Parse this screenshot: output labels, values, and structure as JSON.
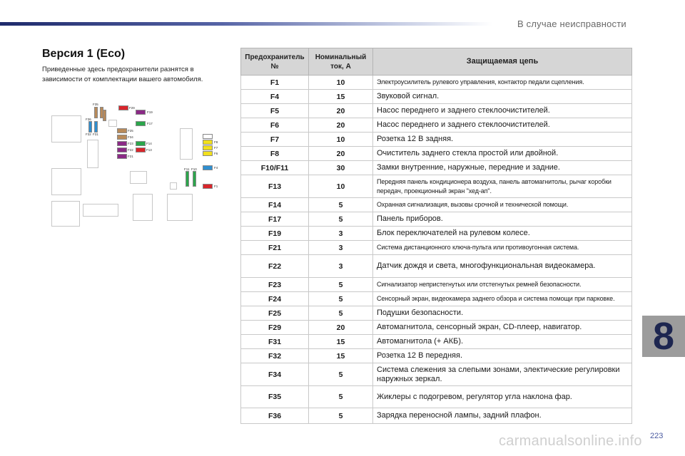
{
  "header": {
    "chapter_title": "В случае неисправности"
  },
  "section": {
    "title": "Версия 1 (Eco)",
    "intro": "Приведенные здесь предохранители разнятся в зависимости от комплектации вашего автомобиля."
  },
  "diagram": {
    "labels": [
      "F29",
      "F19",
      "F17",
      "F25",
      "F34",
      "F23",
      "F22",
      "F21",
      "F14",
      "F13",
      "F35",
      "F36",
      "F32",
      "F31",
      "F8",
      "F7",
      "F6",
      "F4",
      "F1",
      "F11",
      "F10"
    ],
    "colors": {
      "red": "#d9252b",
      "purple": "#8b2a86",
      "green": "#2ba64b",
      "yellow": "#f2e01c",
      "blue": "#2f8fd0",
      "tan": "#b88a5a"
    }
  },
  "table": {
    "headers": {
      "fuse": "Предохранитель №",
      "current": "Номинальный ток, А",
      "description": "Защищаемая цепь"
    },
    "rows": [
      {
        "fuse": "F1",
        "amps": "10",
        "desc": "Электроусилитель рулевого управления, контактор педали сцепления.",
        "small": true
      },
      {
        "fuse": "F4",
        "amps": "15",
        "desc": "Звуковой сигнал.",
        "small": false
      },
      {
        "fuse": "F5",
        "amps": "20",
        "desc": "Насос переднего и заднего стеклоочистителей.",
        "small": false
      },
      {
        "fuse": "F6",
        "amps": "20",
        "desc": "Насос переднего и заднего стеклоочистителей.",
        "small": false
      },
      {
        "fuse": "F7",
        "amps": "10",
        "desc": "Розетка 12 В задняя.",
        "small": false
      },
      {
        "fuse": "F8",
        "amps": "20",
        "desc": "Очиститель заднего стекла простой или двойной.",
        "small": false
      },
      {
        "fuse": "F10/F11",
        "amps": "30",
        "desc": "Замки внутренние, наружные, передние и задние.",
        "small": false
      },
      {
        "fuse": "F13",
        "amps": "10",
        "desc": "Передняя панель кондиционера воздуха, панель автомагнитолы, рычаг коробки передач, проекционный экран \"хед-ап\".",
        "small": true
      },
      {
        "fuse": "F14",
        "amps": "5",
        "desc": "Охранная сигнализация, вызовы срочной и технической помощи.",
        "small": true
      },
      {
        "fuse": "F17",
        "amps": "5",
        "desc": "Панель приборов.",
        "small": false
      },
      {
        "fuse": "F19",
        "amps": "3",
        "desc": "Блок переключателей на рулевом колесе.",
        "small": false
      },
      {
        "fuse": "F21",
        "amps": "3",
        "desc": "Система дистанционного ключа-пульта или противоугонная система.",
        "small": true
      },
      {
        "fuse": "F22",
        "amps": "3",
        "desc": "Датчик дождя и света, многофункциональная видеокамера.",
        "small": false
      },
      {
        "fuse": "F23",
        "amps": "5",
        "desc": "Сигнализатор непристегнутых или отстегнутых ремней безопасности.",
        "small": true
      },
      {
        "fuse": "F24",
        "amps": "5",
        "desc": "Сенсорный экран, видеокамера заднего обзора и система помощи при парковке.",
        "small": true
      },
      {
        "fuse": "F25",
        "amps": "5",
        "desc": "Подушки безопасности.",
        "small": false
      },
      {
        "fuse": "F29",
        "amps": "20",
        "desc": "Автомагнитола, сенсорный экран, CD-плеер, навигатор.",
        "small": false
      },
      {
        "fuse": "F31",
        "amps": "15",
        "desc": "Автомагнитола (+ АКБ).",
        "small": false
      },
      {
        "fuse": "F32",
        "amps": "15",
        "desc": "Розетка 12 В передняя.",
        "small": false
      },
      {
        "fuse": "F34",
        "amps": "5",
        "desc": "Система слежения за слепыми зонами, электические регулировки наружных зеркал.",
        "small": false
      },
      {
        "fuse": "F35",
        "amps": "5",
        "desc": "Жиклеры с подогревом, регулятор угла наклона фар.",
        "small": false
      },
      {
        "fuse": "F36",
        "amps": "5",
        "desc": "Зарядка переносной лампы, задний плафон.",
        "small": false
      }
    ]
  },
  "footer": {
    "chapter_number": "8",
    "page_number": "223",
    "watermark": "carmanualsonline.info"
  }
}
